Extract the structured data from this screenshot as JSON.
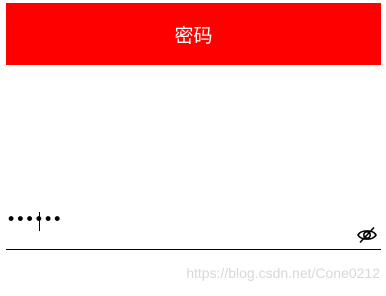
{
  "header": {
    "title": "密码",
    "background_color": "#ff0000",
    "text_color": "#ffffff"
  },
  "password_field": {
    "value": "••••••",
    "toggle_icon": "eye-off-icon",
    "underline_color": "#000000"
  },
  "watermark": {
    "text": "https://blog.csdn.net/Cone0212"
  }
}
